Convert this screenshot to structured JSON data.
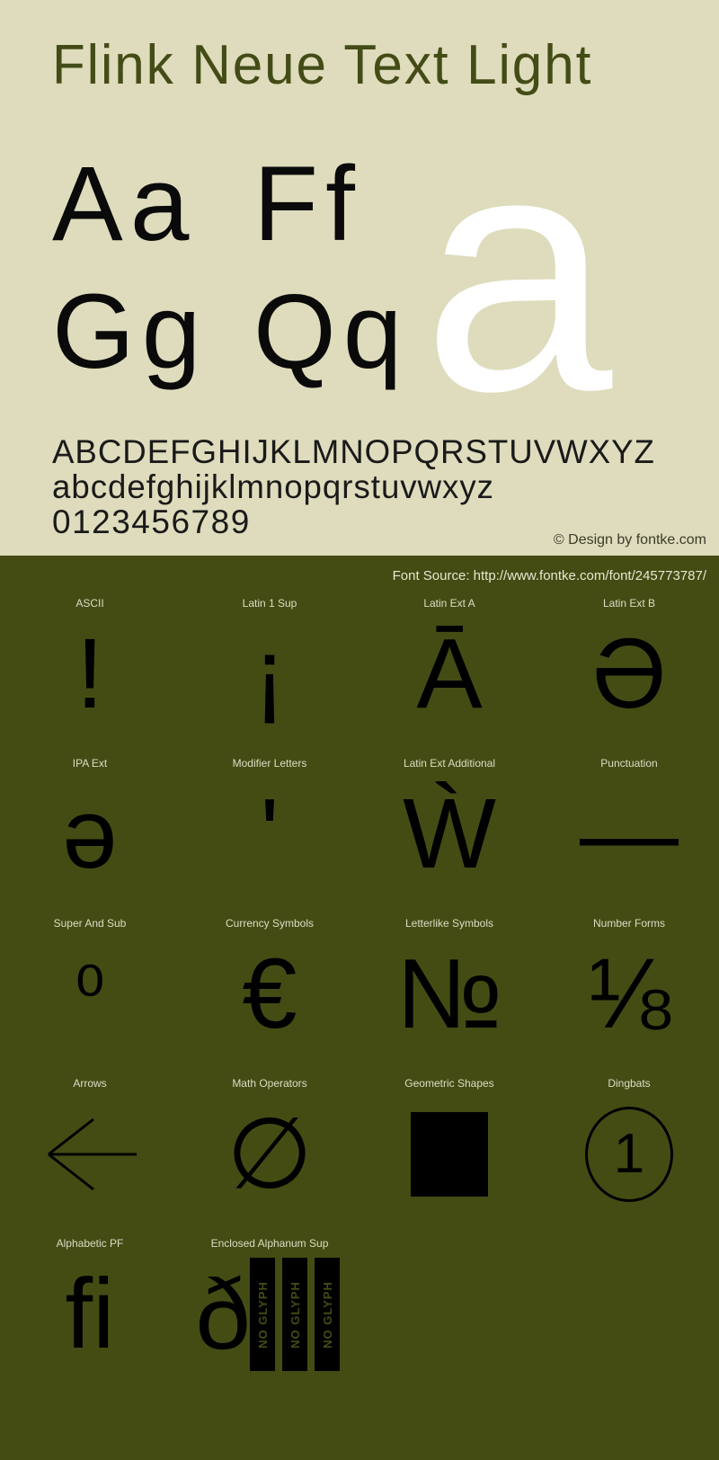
{
  "specimen": {
    "title": "Flink Neue Text Light",
    "copyright": "© Design by fontke.com",
    "font_source": "Font Source: http://www.fontke.com/font/245773787/",
    "colors": {
      "light_background": "#dedcbc",
      "dark_background": "#444c14",
      "glyph_black": "#000000",
      "hero_white": "#ffffff",
      "title_olive": "#434c16",
      "label_cream": "#ddddc4"
    },
    "pairs": [
      {
        "name": "a-pair",
        "text": "Aa"
      },
      {
        "name": "f-pair",
        "text": "Ff"
      },
      {
        "name": "g-pair",
        "text": "Gg"
      },
      {
        "name": "q-pair",
        "text": "Qq"
      }
    ],
    "hero_glyph": "a",
    "alphabet": {
      "uppercase": "ABCDEFGHIJKLMNOPQRSTUVWXYZ",
      "lowercase": "abcdefghijklmnopqrstuvwxyz",
      "digits": "0123456789"
    }
  },
  "unicode_blocks": {
    "rows": [
      [
        {
          "label": "ASCII",
          "glyph": "!",
          "render": "text",
          "size": "default"
        },
        {
          "label": "Latin 1 Sup",
          "glyph": "¡",
          "render": "text",
          "size": "default"
        },
        {
          "label": "Latin Ext A",
          "glyph": "Ā",
          "render": "text",
          "size": "default"
        },
        {
          "label": "Latin Ext B",
          "glyph": "Ə",
          "render": "text",
          "size": "default"
        }
      ],
      [
        {
          "label": "IPA Ext",
          "glyph": "ə",
          "render": "text",
          "size": "default"
        },
        {
          "label": "Modifier Letters",
          "glyph": "ʹ",
          "render": "text",
          "size": "default"
        },
        {
          "label": "Latin Ext Additional",
          "glyph": "Ẁ",
          "render": "text",
          "size": "default"
        },
        {
          "label": "Punctuation",
          "glyph": "—",
          "render": "text",
          "size": "default"
        }
      ],
      [
        {
          "label": "Super And Sub",
          "glyph": "⁰",
          "render": "text",
          "size": "default"
        },
        {
          "label": "Currency Symbols",
          "glyph": "€",
          "render": "text",
          "size": "default"
        },
        {
          "label": "Letterlike Symbols",
          "glyph": "№",
          "render": "text",
          "size": "default"
        },
        {
          "label": "Number Forms",
          "glyph": "⅛",
          "render": "text",
          "size": "default"
        }
      ],
      [
        {
          "label": "Arrows",
          "glyph": "←",
          "render": "arrow",
          "size": "default"
        },
        {
          "label": "Math Operators",
          "glyph": "∅",
          "render": "text",
          "size": "default"
        },
        {
          "label": "Geometric Shapes",
          "glyph": "■",
          "render": "square",
          "size": "default"
        },
        {
          "label": "Dingbats",
          "glyph": "①",
          "render": "circled",
          "size": "default"
        }
      ],
      [
        {
          "label": "Alphabetic PF",
          "glyph": "ﬁ",
          "render": "text",
          "size": "default"
        },
        {
          "label": "Enclosed Alphanum Sup",
          "glyph": "ð",
          "render": "noglyph",
          "size": "default"
        },
        {
          "label": "",
          "glyph": "",
          "render": "empty",
          "size": "default"
        },
        {
          "label": "",
          "glyph": "",
          "render": "empty",
          "size": "default"
        }
      ]
    ],
    "no_glyph_label": "NO GLYPH",
    "no_glyph_count": 3
  }
}
